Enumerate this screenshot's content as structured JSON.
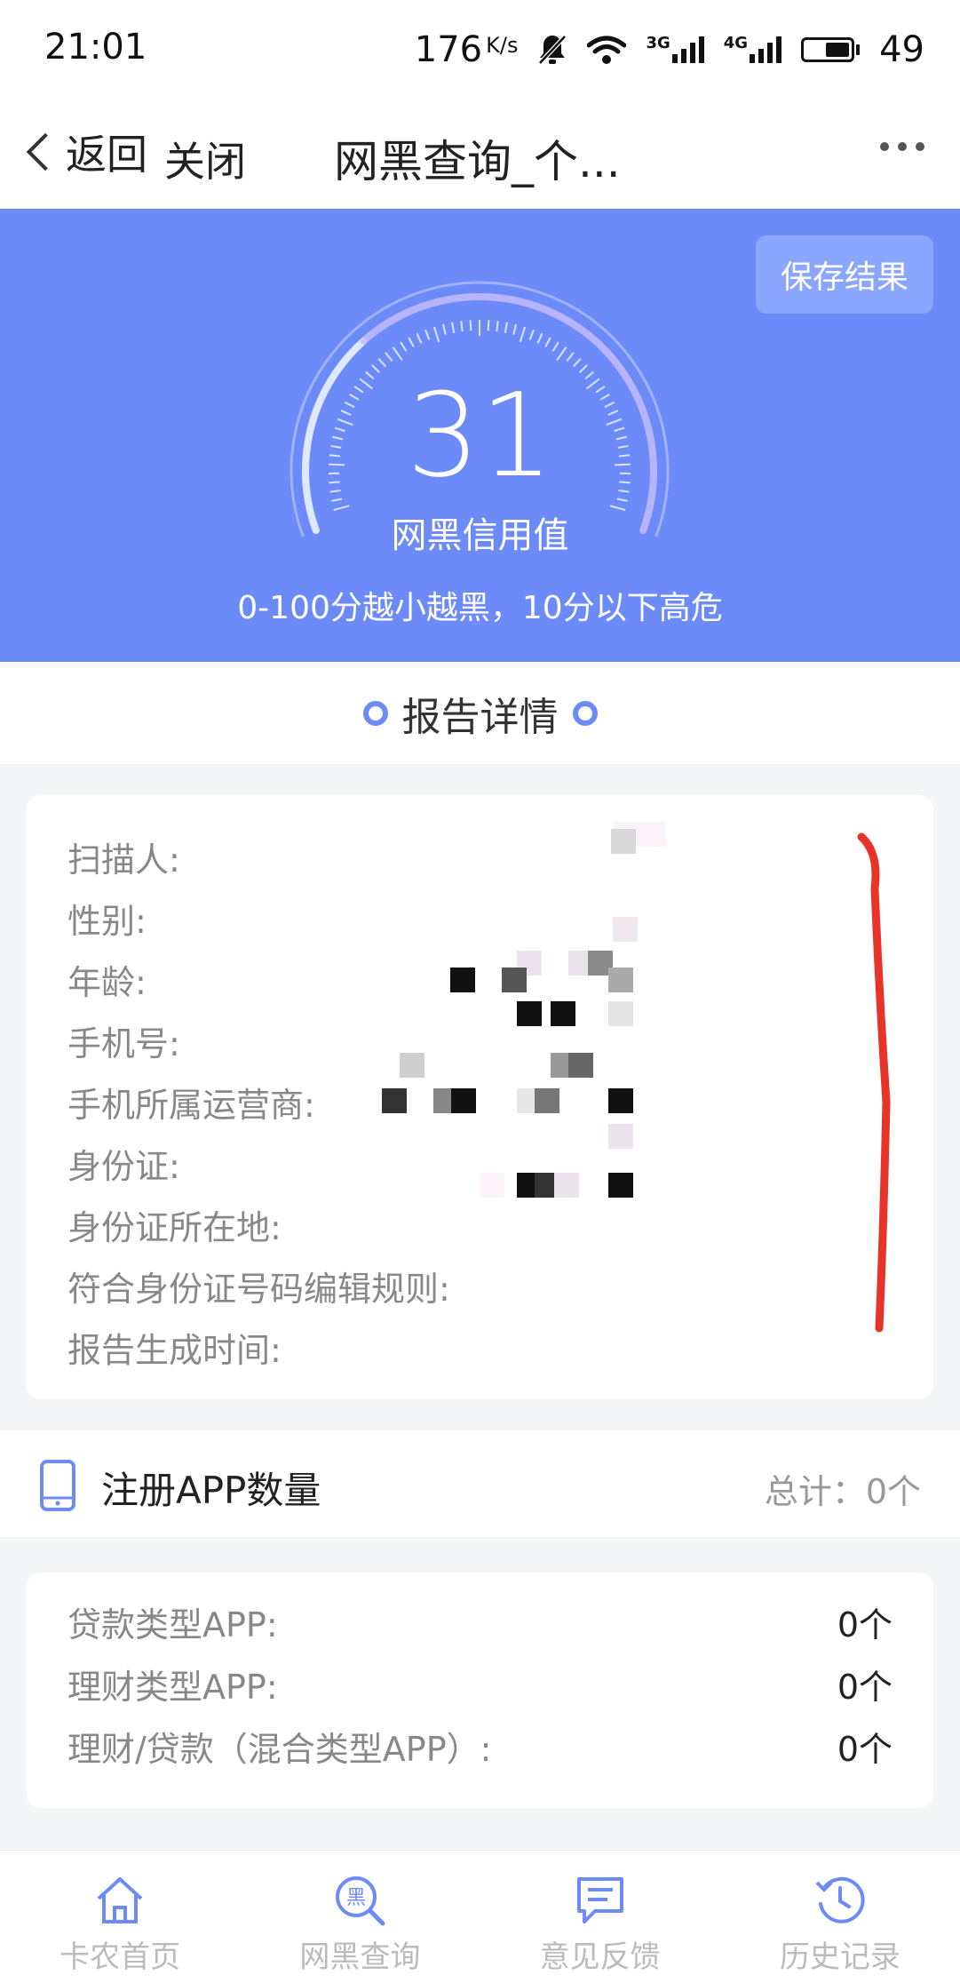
{
  "status": {
    "time": "21:01",
    "net_speed": "176",
    "net_speed_unit": "K/s",
    "sim1": "3G",
    "sim2": "4G",
    "battery": "49"
  },
  "nav": {
    "back_label": "返回",
    "close_label": "关闭",
    "title": "网黑查询_个..."
  },
  "hero": {
    "save_label": "保存结果",
    "score": "31",
    "score_label": "网黑信用值",
    "note": "0-100分越小越黑，10分以下高危",
    "score_fraction": 0.31
  },
  "report": {
    "title": "报告详情",
    "rows": [
      {
        "label": "扫描人:",
        "value": ""
      },
      {
        "label": "性别:",
        "value": ""
      },
      {
        "label": "年龄:",
        "value": ""
      },
      {
        "label": "手机号:",
        "value": ""
      },
      {
        "label": "手机所属运营商:",
        "value": ""
      },
      {
        "label": "身份证:",
        "value": ""
      },
      {
        "label": "身份证所在地:",
        "value": ""
      },
      {
        "label": "符合身份证号码编辑规则:",
        "value": ""
      },
      {
        "label": "报告生成时间:",
        "value": ""
      }
    ]
  },
  "apps": {
    "title": "注册APP数量",
    "total": "总计：0个",
    "rows": [
      {
        "label": "贷款类型APP:",
        "value": "0个"
      },
      {
        "label": "理财类型APP:",
        "value": "0个"
      },
      {
        "label": "理财/贷款（混合类型APP）:",
        "value": "0个"
      }
    ]
  },
  "tabs": [
    {
      "label": "卡农首页",
      "icon": "home-icon"
    },
    {
      "label": "网黑查询",
      "icon": "blacklist-search-icon",
      "icon_char": "黑"
    },
    {
      "label": "意见反馈",
      "icon": "feedback-icon"
    },
    {
      "label": "历史记录",
      "icon": "history-icon"
    }
  ],
  "colors": {
    "accent": "#6d8bf8",
    "annotation": "#e8332a"
  }
}
